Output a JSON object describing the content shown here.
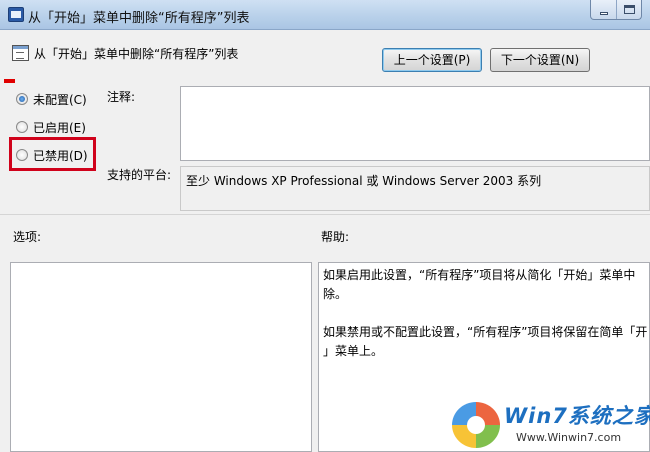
{
  "window": {
    "title": "从「开始」菜单中删除“所有程序”列表",
    "header_title": "从「开始」菜单中删除“所有程序”列表",
    "prev_button": "上一个设置(P)",
    "next_button": "下一个设置(N)"
  },
  "radios": [
    {
      "label": "未配置(C)",
      "checked": true
    },
    {
      "label": "已启用(E)",
      "checked": false
    },
    {
      "label": "已禁用(D)",
      "checked": false
    }
  ],
  "comment_label": "注释:",
  "comment_value": "",
  "supported_label": "支持的平台:",
  "supported_value": "至少 Windows XP Professional 或 Windows Server 2003 系列",
  "options_label": "选项:",
  "help_label": "帮助:",
  "help_lines": [
    "如果启用此设置，“所有程序”项目将从简化「开始」菜单中",
    "除。",
    "",
    "如果禁用或不配置此设置，“所有程序”项目将保留在简单「开",
    "」菜单上。"
  ],
  "watermark": {
    "title": "Win7系统之家",
    "url": "Www.Winwin7.com"
  },
  "colors": {
    "highlight": "#d0021b",
    "accent": "#1c5aa8"
  },
  "icons": [
    "policy-window-icon",
    "policy-setting-icon",
    "minimize-icon",
    "maximize-icon"
  ]
}
